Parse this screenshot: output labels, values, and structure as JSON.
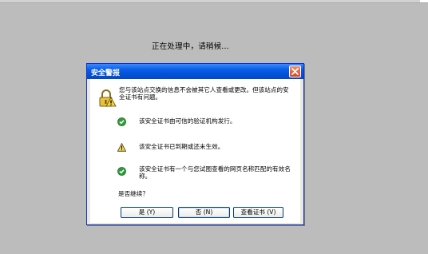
{
  "page": {
    "processing_text": "正在处理中，请稍候..."
  },
  "dialog": {
    "title": "安全警报",
    "close_icon": "close-icon",
    "intro": "您与该站点交换的信息不会被其它人查看或更改。但该站点的安全证书有问题。",
    "items": [
      {
        "icon": "check-circle-icon",
        "text": "该安全证书由可信的验证机构发行。"
      },
      {
        "icon": "warning-triangle-icon",
        "text": "该安全证书已到期或还未生效。"
      },
      {
        "icon": "check-circle-icon",
        "text": "该安全证书有一个与您试图查看的网页名称匹配的有效名称。"
      }
    ],
    "question": "是否继续？",
    "buttons": {
      "yes": "是 (Y)",
      "no": "否 (N)",
      "view_cert": "查看证书 (V)"
    }
  },
  "colors": {
    "titlebar": "#0a5fe8",
    "dialog_face": "#ece9d8",
    "background": "#bcbcbc",
    "ok_green": "#2e9e3a",
    "warning_yellow": "#f3d338"
  }
}
